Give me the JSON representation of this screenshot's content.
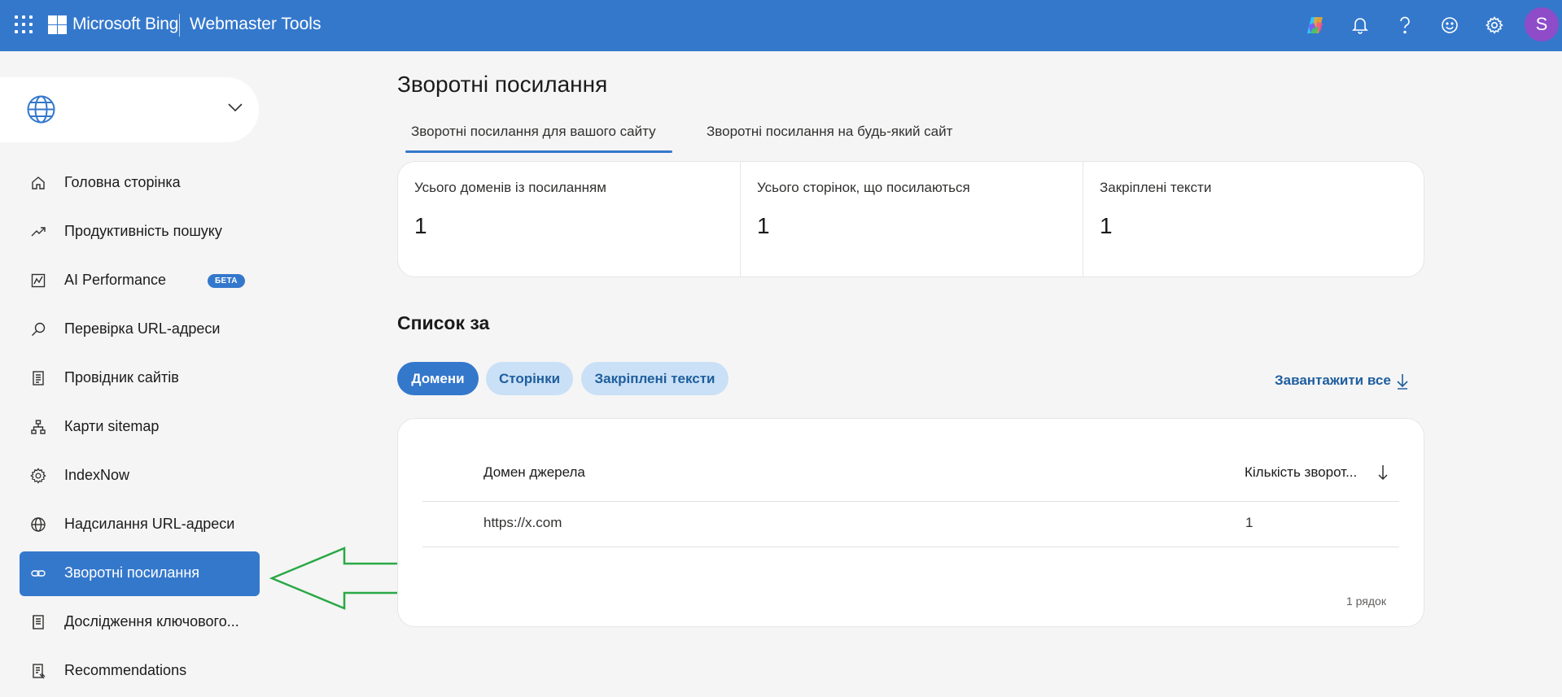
{
  "topbar": {
    "brand": "Microsoft Bing",
    "product": "Webmaster Tools",
    "icons": [
      "waffle-icon",
      "copilot-icon",
      "bell-icon",
      "help-icon",
      "smiley-icon",
      "gear-icon"
    ],
    "avatar_initial": "S",
    "colors": {
      "bar": "#3478cc",
      "avatar": "#8e4cc9"
    }
  },
  "site_selector": {
    "value": "",
    "icon": "globe-icon"
  },
  "sidebar": {
    "items": [
      {
        "label": "Головна сторінка",
        "icon": "home-icon"
      },
      {
        "label": "Продуктивність пошуку",
        "icon": "trend-icon"
      },
      {
        "label": "AI Performance",
        "icon": "chart-icon",
        "badge": "БЕТА"
      },
      {
        "label": "Перевірка URL-адреси",
        "icon": "search-icon"
      },
      {
        "label": "Провідник сайтів",
        "icon": "document-icon"
      },
      {
        "label": "Карти sitemap",
        "icon": "sitemap-icon"
      },
      {
        "label": "IndexNow",
        "icon": "gear-icon"
      },
      {
        "label": "Надсилання URL-адреси",
        "icon": "globe-icon"
      },
      {
        "label": "Зворотні посилання",
        "icon": "link-icon",
        "active": true
      },
      {
        "label": "Дослідження ключового...",
        "icon": "book-icon"
      },
      {
        "label": "Recommendations",
        "icon": "clipboard-icon"
      }
    ]
  },
  "main": {
    "title": "Зворотні посилання",
    "tabs": [
      {
        "label": "Зворотні посилання для вашого сайту",
        "active": true
      },
      {
        "label": "Зворотні посилання на будь-який сайт",
        "active": false
      }
    ],
    "stats": [
      {
        "label": "Усього доменів із посиланням",
        "value": "1"
      },
      {
        "label": "Усього сторінок, що посилаються",
        "value": "1"
      },
      {
        "label": "Закріплені тексти",
        "value": "1"
      }
    ],
    "list_title": "Список за",
    "filters": [
      {
        "label": "Домени",
        "active": true
      },
      {
        "label": "Сторінки",
        "active": false
      },
      {
        "label": "Закріплені тексти",
        "active": false
      }
    ],
    "download_label": "Завантажити все",
    "table": {
      "columns": [
        "Домен джерела",
        "Кількість зворот..."
      ],
      "rows": [
        {
          "domain": "https://x.com",
          "count": "1"
        }
      ],
      "row_count": "1 рядок"
    }
  }
}
